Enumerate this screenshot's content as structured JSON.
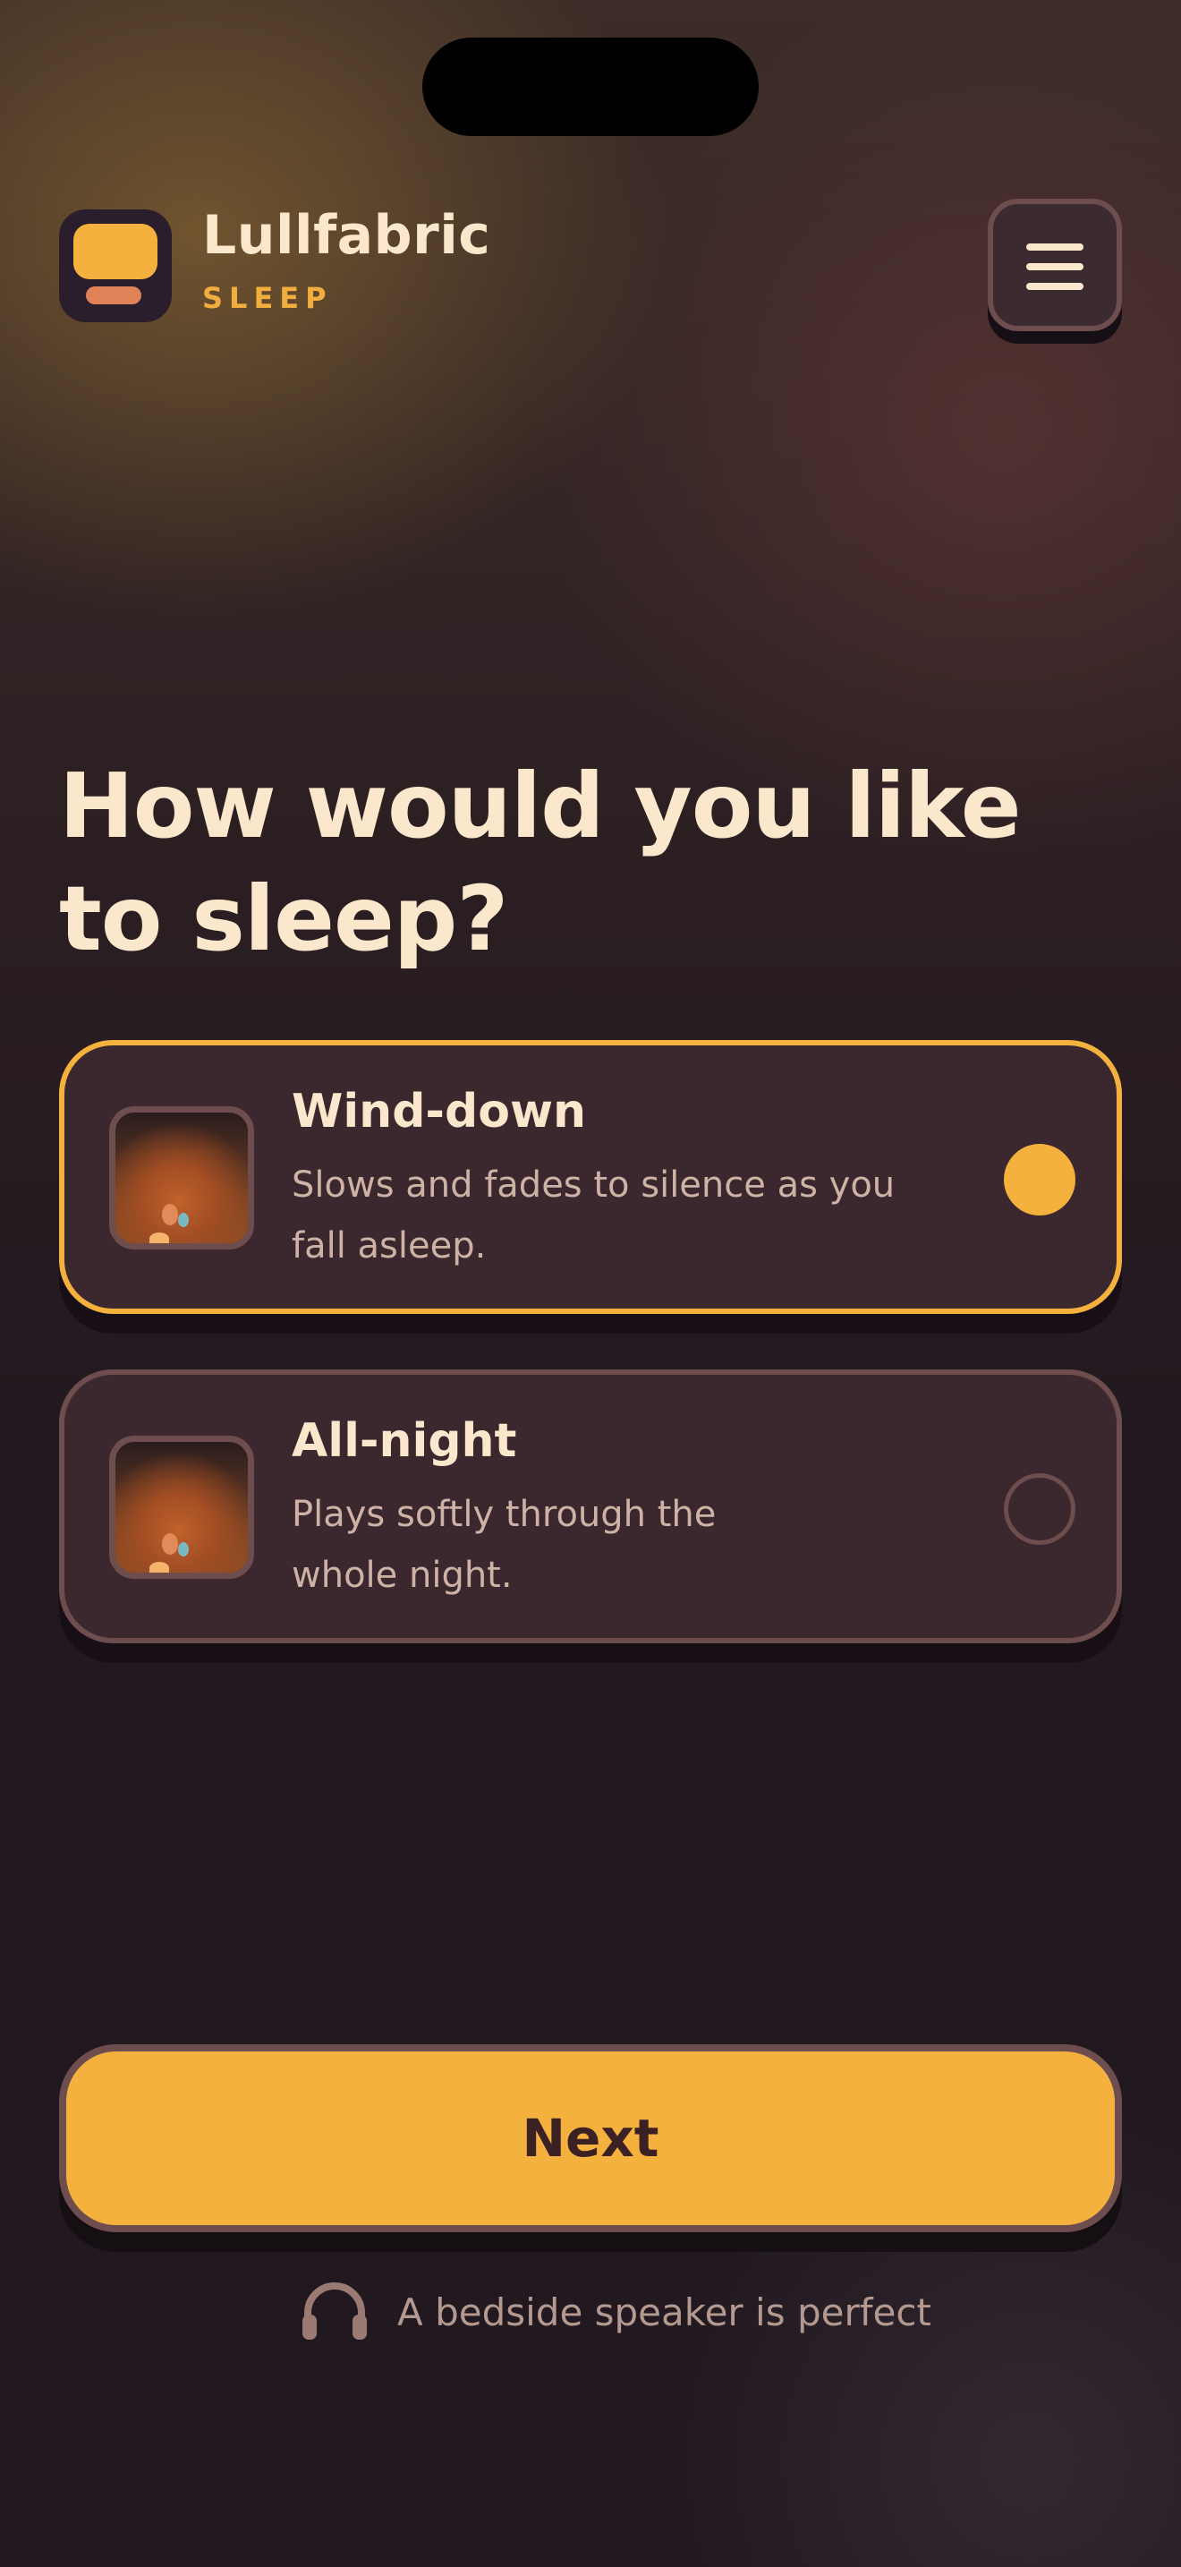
{
  "app": {
    "name": "Lullfabric",
    "subtitle": "SLEEP"
  },
  "heading": "How would you like to sleep?",
  "options": [
    {
      "title": "Wind-down",
      "description": "Slows and fades to silence as you fall asleep.",
      "selected": true
    },
    {
      "title": "All-night",
      "description": "Plays softly through the whole night.",
      "selected": false
    }
  ],
  "next_label": "Next",
  "hint": {
    "icon": "headphones-icon",
    "text": "A bedside speaker is perfect"
  },
  "colors": {
    "accent": "#f4b13e",
    "text": "#fbe8cc",
    "card": "#3b272e",
    "border": "#6e4d4f",
    "background": "#201820"
  }
}
